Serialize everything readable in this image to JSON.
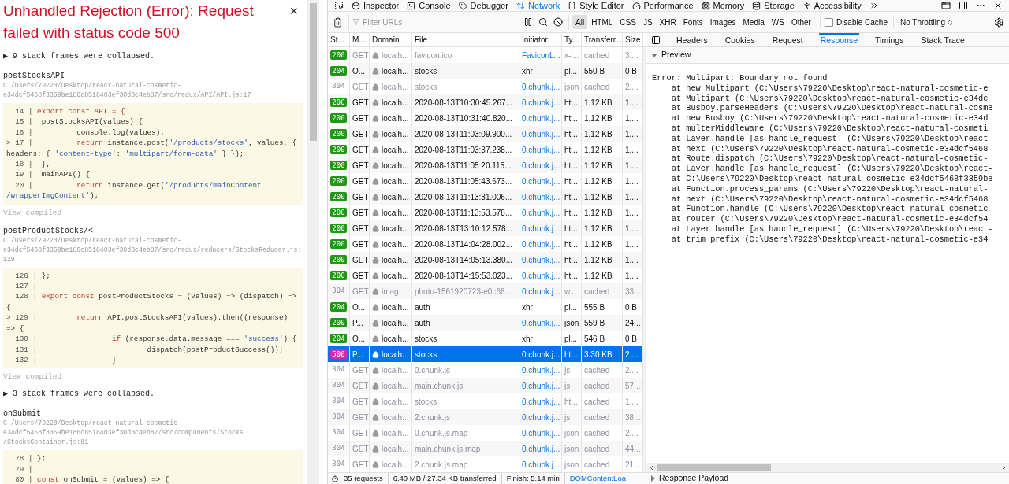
{
  "error_overlay": {
    "title": "Unhandled Rejection (Error): Request failed with status code 500",
    "close": "×",
    "sections": [
      {
        "kind": "collapsed",
        "text": "▶ 9 stack frames were collapsed."
      },
      {
        "kind": "frame",
        "function": "postStocksAPI",
        "path": "C:/Users/79220/Desktop/react-natural-cosmetic-e34dcf5468f3359be186c8518403ef30d3c4eb87/src/redux/API/API.js:17",
        "link": "View compiled",
        "lines": [
          {
            "gutter": "  14 | ",
            "code": [
              {
                "kind": "kw",
                "t": "export const API = {"
              }
            ]
          },
          {
            "gutter": "  15 | ",
            "code": [
              {
                "kind": "plain",
                "t": " postStocksAPI(values) {"
              }
            ]
          },
          {
            "gutter": "  16 | ",
            "code": [
              {
                "kind": "plain",
                "t": "         console.log(values);"
              }
            ]
          },
          {
            "gutter": "> 17 | ",
            "code": [
              {
                "kind": "kw",
                "t": "         return"
              },
              {
                "kind": "plain",
                "t": " instance.post("
              },
              {
                "kind": "str",
                "t": "'/products/stocks'"
              },
              {
                "kind": "plain",
                "t": ", values, { headers: { "
              },
              {
                "kind": "str",
                "t": "'content-type'"
              },
              {
                "kind": "plain",
                "t": ": "
              },
              {
                "kind": "str",
                "t": "'multipart/form-data'"
              },
              {
                "kind": "plain",
                "t": " } });"
              }
            ]
          },
          {
            "gutter": "  18 | ",
            "code": [
              {
                "kind": "plain",
                "t": " },"
              }
            ]
          },
          {
            "gutter": "  19 | ",
            "code": [
              {
                "kind": "plain",
                "t": " mainAPI() {"
              }
            ]
          },
          {
            "gutter": "  20 | ",
            "code": [
              {
                "kind": "kw",
                "t": "         return"
              },
              {
                "kind": "plain",
                "t": " instance.get("
              },
              {
                "kind": "str",
                "t": "'/products/mainContent /wrapperImgContent'"
              },
              {
                "kind": "plain",
                "t": ");"
              }
            ]
          }
        ]
      },
      {
        "kind": "frame",
        "function": "postProductStocks/<",
        "path": "C:/Users/79220/Desktop/react-natural-cosmetic-e34dcf5468f3359be186c8518403ef30d3c4eb87/src/redux/reducers/StocksReducer.js:129",
        "link": "View compiled",
        "lines": [
          {
            "gutter": "  126 | ",
            "code": [
              {
                "kind": "plain",
                "t": "};"
              }
            ]
          },
          {
            "gutter": "  127 | "
          },
          {
            "gutter": "  128 | ",
            "code": [
              {
                "kind": "kw",
                "t": "export const"
              },
              {
                "kind": "plain",
                "t": " postProductStocks = (values) => (dispatch) => {"
              }
            ]
          },
          {
            "gutter": "> 129 | ",
            "code": [
              {
                "kind": "kw",
                "t": "        return"
              },
              {
                "kind": "plain",
                "t": " API.postStocksAPI(values).then((response) => {"
              }
            ]
          },
          {
            "gutter": "  130 | ",
            "code": [
              {
                "kind": "kw",
                "t": "                if"
              },
              {
                "kind": "plain",
                "t": " (response.data.message === "
              },
              {
                "kind": "str",
                "t": "'success'"
              },
              {
                "kind": "plain",
                "t": ") {"
              }
            ]
          },
          {
            "gutter": "  131 | ",
            "code": [
              {
                "kind": "plain",
                "t": "                        dispatch(postProductSuccess());"
              }
            ]
          },
          {
            "gutter": "  132 | ",
            "code": [
              {
                "kind": "plain",
                "t": "                }"
              }
            ]
          }
        ]
      },
      {
        "kind": "collapsed",
        "text": "▶ 3 stack frames were collapsed."
      },
      {
        "kind": "frame",
        "function": "onSubmit",
        "path": "C:/Users/79220/Desktop/react-natural-cosmetic-e34dcf5468f3359be186c8518403ef30d3c4eb87/src/components/Stocks /StocksContainer.js:81",
        "lines": [
          {
            "gutter": "  78 | ",
            "code": [
              {
                "kind": "plain",
                "t": "};"
              }
            ]
          },
          {
            "gutter": "  79 | "
          },
          {
            "gutter": "  80 | ",
            "code": [
              {
                "kind": "kw",
                "t": "const"
              },
              {
                "kind": "plain",
                "t": " onSubmit = (values) => {"
              }
            ]
          }
        ]
      }
    ]
  },
  "devtools": {
    "tools": [
      {
        "label": "Inspector",
        "selected": false
      },
      {
        "label": "Console",
        "selected": false
      },
      {
        "label": "Debugger",
        "selected": false
      },
      {
        "label": "Network",
        "selected": true
      },
      {
        "label": "Style Editor",
        "selected": false
      },
      {
        "label": "Performance",
        "selected": false
      },
      {
        "label": "Memory",
        "selected": false
      },
      {
        "label": "Storage",
        "selected": false
      },
      {
        "label": "Accessibility",
        "selected": false
      }
    ],
    "toolbar": {
      "filter_placeholder": "Filter URLs",
      "filters": [
        {
          "label": "All",
          "selected": true
        },
        {
          "label": "HTML",
          "selected": false
        },
        {
          "label": "CSS",
          "selected": false
        },
        {
          "label": "JS",
          "selected": false
        },
        {
          "label": "XHR",
          "selected": false
        },
        {
          "label": "Fonts",
          "selected": false
        },
        {
          "label": "Images",
          "selected": false
        },
        {
          "label": "Media",
          "selected": false
        },
        {
          "label": "WS",
          "selected": false
        },
        {
          "label": "Other",
          "selected": false
        }
      ],
      "disable_cache": {
        "label": "Disable Cache",
        "checked": false
      },
      "throttling": "No Throttling"
    },
    "columns": [
      "St...",
      "M...",
      "Domain",
      "File",
      "Initiator",
      "Ty...",
      "Transferr...",
      "Size"
    ],
    "rows": [
      {
        "status": "200",
        "color": "#1e9a12",
        "method": "GET",
        "domain": "localh...",
        "file": "favicon.ico",
        "initiator": "FaviconL...",
        "link": true,
        "type": "x-i...",
        "transferred": "cached",
        "size": "3....",
        "dim": true,
        "selected": false
      },
      {
        "status": "204",
        "color": "#1e9a12",
        "method": "O...",
        "domain": "localh...",
        "file": "stocks",
        "initiator": "xhr",
        "link": false,
        "type": "pl...",
        "transferred": "550 B",
        "size": "0 B",
        "dim": false,
        "selected": false
      },
      {
        "status": "304",
        "method": "GET",
        "domain": "localh...",
        "file": "stocks",
        "initiator": "0.chunk.j...",
        "link": true,
        "type": "json",
        "transferred": "cached",
        "size": "2....",
        "dim": true,
        "selected": false
      },
      {
        "status": "200",
        "color": "#1e9a12",
        "method": "GET",
        "domain": "localh...",
        "file": "2020-08-13T10:30:45.267...",
        "initiator": "0.chunk.j...",
        "link": true,
        "type": "ht...",
        "transferred": "1.12 KB",
        "size": "1....",
        "dim": false,
        "selected": false
      },
      {
        "status": "200",
        "color": "#1e9a12",
        "method": "GET",
        "domain": "localh...",
        "file": "2020-08-13T10:31:40.820...",
        "initiator": "0.chunk.j...",
        "link": true,
        "type": "ht...",
        "transferred": "1.12 KB",
        "size": "1....",
        "dim": false,
        "selected": false
      },
      {
        "status": "200",
        "color": "#1e9a12",
        "method": "GET",
        "domain": "localh...",
        "file": "2020-08-13T11:03:09.900...",
        "initiator": "0.chunk.j...",
        "link": true,
        "type": "ht...",
        "transferred": "1.12 KB",
        "size": "1....",
        "dim": false,
        "selected": false
      },
      {
        "status": "200",
        "color": "#1e9a12",
        "method": "GET",
        "domain": "localh...",
        "file": "2020-08-13T11:03:37.238...",
        "initiator": "0.chunk.j...",
        "link": true,
        "type": "ht...",
        "transferred": "1.12 KB",
        "size": "1....",
        "dim": false,
        "selected": false
      },
      {
        "status": "200",
        "color": "#1e9a12",
        "method": "GET",
        "domain": "localh...",
        "file": "2020-08-13T11:05:20.115...",
        "initiator": "0.chunk.j...",
        "link": true,
        "type": "ht...",
        "transferred": "1.12 KB",
        "size": "1....",
        "dim": false,
        "selected": false
      },
      {
        "status": "200",
        "color": "#1e9a12",
        "method": "GET",
        "domain": "localh...",
        "file": "2020-08-13T11:05:43.673...",
        "initiator": "0.chunk.j...",
        "link": true,
        "type": "ht...",
        "transferred": "1.12 KB",
        "size": "1....",
        "dim": false,
        "selected": false
      },
      {
        "status": "200",
        "color": "#1e9a12",
        "method": "GET",
        "domain": "localh...",
        "file": "2020-08-13T11:13:31.006...",
        "initiator": "0.chunk.j...",
        "link": true,
        "type": "ht...",
        "transferred": "1.12 KB",
        "size": "1....",
        "dim": false,
        "selected": false
      },
      {
        "status": "200",
        "color": "#1e9a12",
        "method": "GET",
        "domain": "localh...",
        "file": "2020-08-13T11:13:53.578...",
        "initiator": "0.chunk.j...",
        "link": true,
        "type": "ht...",
        "transferred": "1.12 KB",
        "size": "1....",
        "dim": false,
        "selected": false
      },
      {
        "status": "200",
        "color": "#1e9a12",
        "method": "GET",
        "domain": "localh...",
        "file": "2020-08-13T13:10:12.578...",
        "initiator": "0.chunk.j...",
        "link": true,
        "type": "ht...",
        "transferred": "1.12 KB",
        "size": "1....",
        "dim": false,
        "selected": false
      },
      {
        "status": "200",
        "color": "#1e9a12",
        "method": "GET",
        "domain": "localh...",
        "file": "2020-08-13T14:04:28.002...",
        "initiator": "0.chunk.j...",
        "link": true,
        "type": "ht...",
        "transferred": "1.12 KB",
        "size": "1....",
        "dim": false,
        "selected": false
      },
      {
        "status": "200",
        "color": "#1e9a12",
        "method": "GET",
        "domain": "localh...",
        "file": "2020-08-13T14:05:13.380...",
        "initiator": "0.chunk.j...",
        "link": true,
        "type": "ht...",
        "transferred": "1.12 KB",
        "size": "1....",
        "dim": false,
        "selected": false
      },
      {
        "status": "200",
        "color": "#1e9a12",
        "method": "GET",
        "domain": "localh...",
        "file": "2020-08-13T14:15:53.023...",
        "initiator": "0.chunk.j...",
        "link": true,
        "type": "ht...",
        "transferred": "1.12 KB",
        "size": "1....",
        "dim": false,
        "selected": false
      },
      {
        "status": "304",
        "method": "GET",
        "domain": "imag...",
        "file": "photo-1561920723-e0c68...",
        "initiator": "0.chunk.j...",
        "link": true,
        "type": "w...",
        "transferred": "cached",
        "size": "33...",
        "dim": true,
        "selected": false
      },
      {
        "status": "204",
        "color": "#1e9a12",
        "method": "O...",
        "domain": "localh...",
        "file": "auth",
        "initiator": "xhr",
        "link": false,
        "type": "pl...",
        "transferred": "555 B",
        "size": "0 B",
        "dim": false,
        "selected": false
      },
      {
        "status": "200",
        "color": "#1e9a12",
        "method": "P...",
        "domain": "localh...",
        "file": "auth",
        "initiator": "0.chunk.j...",
        "link": true,
        "type": "json",
        "transferred": "559 B",
        "size": "24...",
        "dim": false,
        "selected": false
      },
      {
        "status": "204",
        "color": "#1e9a12",
        "method": "O...",
        "domain": "localh...",
        "file": "stocks",
        "initiator": "xhr",
        "link": false,
        "type": "pl...",
        "transferred": "546 B",
        "size": "0 B",
        "dim": false,
        "selected": false
      },
      {
        "status": "500",
        "color": "#d62aa8",
        "method": "P...",
        "domain": "localh...",
        "file": "stocks",
        "initiator": "0.chunk.j...",
        "link": true,
        "type": "ht...",
        "transferred": "3.30 KB",
        "size": "2....",
        "dim": false,
        "selected": true
      },
      {
        "status": "304",
        "method": "GET",
        "domain": "localh...",
        "file": "0.chunk.js",
        "initiator": "0.chunk.j...",
        "link": true,
        "type": "js",
        "transferred": "cached",
        "size": "2....",
        "dim": true,
        "selected": false
      },
      {
        "status": "304",
        "method": "GET",
        "domain": "localh...",
        "file": "main.chunk.js",
        "initiator": "0.chunk.j...",
        "link": true,
        "type": "js",
        "transferred": "cached",
        "size": "57...",
        "dim": true,
        "selected": false
      },
      {
        "status": "304",
        "method": "GET",
        "domain": "localh...",
        "file": "stocks",
        "initiator": "0.chunk.j...",
        "link": true,
        "type": "ht...",
        "transferred": "cached",
        "size": "1....",
        "dim": true,
        "selected": false
      },
      {
        "status": "304",
        "method": "GET",
        "domain": "localh...",
        "file": "2.chunk.js",
        "initiator": "0.chunk.j...",
        "link": true,
        "type": "js",
        "transferred": "cached",
        "size": "38...",
        "dim": true,
        "selected": false
      },
      {
        "status": "304",
        "method": "GET",
        "domain": "localh...",
        "file": "0.chunk.js.map",
        "initiator": "0.chunk.j...",
        "link": true,
        "type": "json",
        "transferred": "cached",
        "size": "2....",
        "dim": true,
        "selected": false
      },
      {
        "status": "304",
        "method": "GET",
        "domain": "localh...",
        "file": "main.chunk.js.map",
        "initiator": "0.chunk.j...",
        "link": true,
        "type": "json",
        "transferred": "cached",
        "size": "44...",
        "dim": true,
        "selected": false
      },
      {
        "status": "304",
        "method": "GET",
        "domain": "localh...",
        "file": "2.chunk.js.map",
        "initiator": "0.chunk.j...",
        "link": true,
        "type": "json",
        "transferred": "cached",
        "size": "21...",
        "dim": true,
        "selected": false
      }
    ],
    "status_bar": {
      "requests": "35 requests",
      "transferred": "6.40 MB / 27.34 KB transferred",
      "finish": "Finish: 5.14 min",
      "dom": "DOMContentLoa"
    },
    "details": {
      "tabs": [
        {
          "label": "Headers",
          "selected": false
        },
        {
          "label": "Cookies",
          "selected": false
        },
        {
          "label": "Request",
          "selected": false
        },
        {
          "label": "Response",
          "selected": true
        },
        {
          "label": "Timings",
          "selected": false
        },
        {
          "label": "Stack Trace",
          "selected": false
        }
      ],
      "preview": {
        "label": "Preview",
        "expanded": true,
        "text": "Error: Multipart: Boundary not found\n    at new Multipart (C:\\Users\\79220\\Desktop\\react-natural-cosmetic-e\n    at Multipart (C:\\Users\\79220\\Desktop\\react-natural-cosmetic-e34dc\n    at Busboy.parseHeaders (C:\\Users\\79220\\Desktop\\react-natural-cosme\n    at new Busboy (C:\\Users\\79220\\Desktop\\react-natural-cosmetic-e34d\n    at multerMiddleware (C:\\Users\\79220\\Desktop\\react-natural-cosmeti\n    at Layer.handle [as handle_request] (C:\\Users\\79220\\Desktop\\react-\n    at next (C:\\Users\\79220\\Desktop\\react-natural-cosmetic-e34dcf5468\n    at Route.dispatch (C:\\Users\\79220\\Desktop\\react-natural-cosmetic-\n    at Layer.handle [as handle_request] (C:\\Users\\79220\\Desktop\\react-\n    at C:\\Users\\79220\\Desktop\\react-natural-cosmetic-e34dcf5468f3359be\n    at Function.process_params (C:\\Users\\79220\\Desktop\\react-natural-\n    at next (C:\\Users\\79220\\Desktop\\react-natural-cosmetic-e34dcf5468\n    at Function.handle (C:\\Users\\79220\\Desktop\\react-natural-cosmetic-\n    at router (C:\\Users\\79220\\Desktop\\react-natural-cosmetic-e34dcf54\n    at Layer.handle [as handle_request] (C:\\Users\\79220\\Desktop\\react-\n    at trim_prefix (C:\\Users\\79220\\Desktop\\react-natural-cosmetic-e34"
      },
      "payload": {
        "label": "Response Payload",
        "expanded": false
      }
    }
  }
}
